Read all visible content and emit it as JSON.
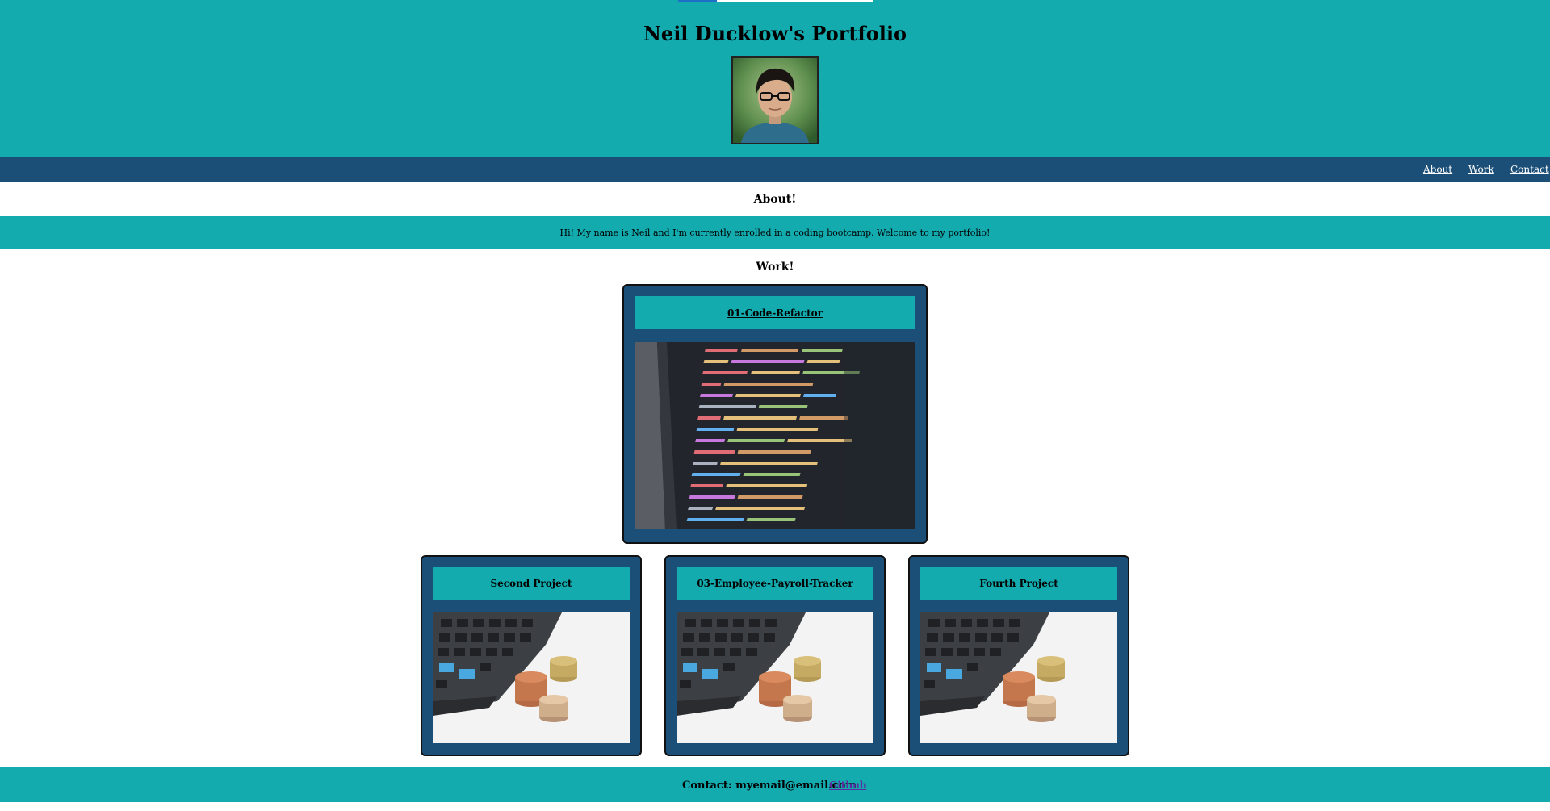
{
  "header": {
    "title": "Neil Ducklow's Portfolio"
  },
  "nav": {
    "items": [
      {
        "label": "About"
      },
      {
        "label": "Work"
      },
      {
        "label": "Contact"
      }
    ]
  },
  "about": {
    "heading": "About!",
    "text": "Hi! My name is Neil and I'm currently enrolled in a coding bootcamp. Welcome to my portfolio!"
  },
  "work": {
    "heading": "Work!",
    "featured": {
      "title": "01-Code-Refactor"
    },
    "projects": [
      {
        "title": "Second Project"
      },
      {
        "title": "03-Employee-Payroll-Tracker"
      },
      {
        "title": "Fourth Project"
      }
    ]
  },
  "footer": {
    "contact": "Contact: myemail@email.com",
    "github_label": "Github"
  },
  "colors": {
    "teal": "#14abaf",
    "navy": "#1b4f78"
  }
}
